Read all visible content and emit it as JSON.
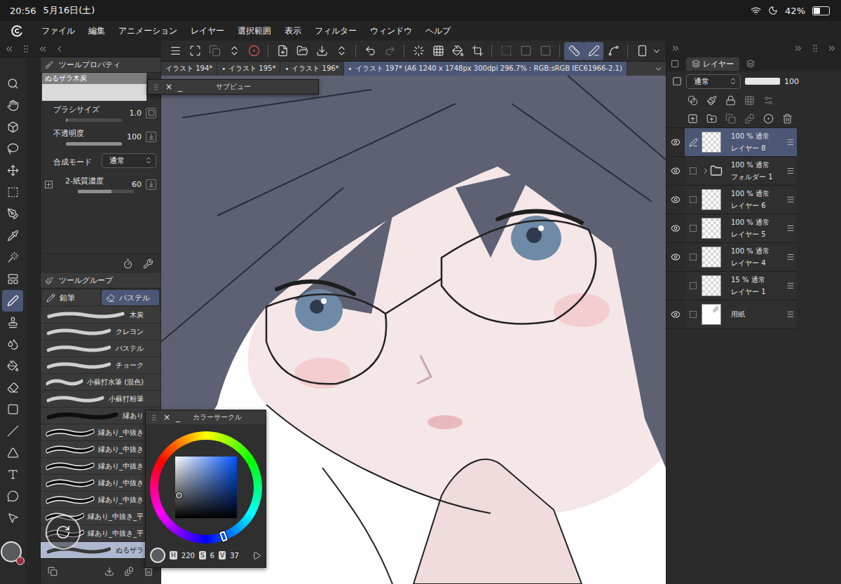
{
  "status_bar": {
    "time": "20:56",
    "date": "5月16日(土)",
    "battery": "42%",
    "battery_level": 0.42
  },
  "menu": [
    "ファイル",
    "編集",
    "アニメーション",
    "レイヤー",
    "選択範囲",
    "表示",
    "フィルター",
    "ウィンドウ",
    "ヘルプ"
  ],
  "command_bar": [
    {
      "selected": false,
      "disabled": false
    },
    {
      "selected": false,
      "disabled": false
    },
    {
      "selected": false,
      "disabled": true
    },
    {
      "selected": false,
      "disabled": false
    },
    {
      "selected": false,
      "disabled": false
    },
    {
      "selected": false,
      "disabled": false
    },
    {
      "selected": false,
      "disabled": false
    },
    {
      "selected": false,
      "disabled": false
    },
    {
      "selected": false,
      "disabled": false
    },
    {
      "selected": false,
      "disabled": false
    },
    {
      "selected": false,
      "disabled": true
    },
    {
      "selected": false,
      "disabled": false
    },
    {
      "selected": false,
      "disabled": false
    },
    {
      "selected": false,
      "disabled": false
    },
    {
      "selected": false,
      "disabled": false
    },
    {
      "selected": false,
      "disabled": true
    },
    {
      "selected": false,
      "disabled": true
    },
    {
      "selected": false,
      "disabled": true
    },
    {
      "selected": true,
      "disabled": false
    },
    {
      "selected": true,
      "disabled": false
    },
    {
      "selected": false,
      "disabled": false
    },
    {
      "selected": false,
      "disabled": false
    }
  ],
  "document_tabs": [
    {
      "label": "イラスト 194*",
      "selected": false
    },
    {
      "marker": "•",
      "label": "イラスト 195*",
      "selected": false
    },
    {
      "marker": "•",
      "label": "イラスト 196*",
      "selected": false
    },
    {
      "marker": "•",
      "label": "イラスト 197* (A6 1240 x 1748px 300dpi 296.7% : RGB:sRGB IEC61966-2.1)",
      "selected": true
    }
  ],
  "tools": [
    {
      "selected": false
    },
    {
      "selected": false
    },
    {
      "selected": false
    },
    {
      "selected": false
    },
    {
      "selected": false
    },
    {
      "selected": false
    },
    {
      "selected": false
    },
    {
      "selected": false
    },
    {
      "selected": false
    },
    {
      "selected": false
    },
    {
      "selected": true
    },
    {
      "selected": false
    },
    {
      "selected": false
    },
    {
      "selected": false
    },
    {
      "selected": false
    },
    {
      "selected": false
    },
    {
      "selected": false
    },
    {
      "selected": false
    },
    {
      "selected": false
    },
    {
      "selected": false
    },
    {
      "selected": false
    }
  ],
  "tool_property": {
    "title": "ツールプロパティ",
    "brush": "ぬるザラ木炭",
    "rows": [
      {
        "kind": "slider",
        "label": "ブラシサイズ",
        "value": "1.0",
        "level": 0.03,
        "expandable": false
      },
      {
        "kind": "slider",
        "label": "不透明度",
        "value": "100",
        "level": 1,
        "expandable": false
      },
      {
        "kind": "select",
        "label": "合成モード",
        "value": "通常",
        "expandable": false
      },
      {
        "kind": "slider",
        "label": "2-紙質濃度",
        "value": "60",
        "level": 0.6,
        "expandable": true
      }
    ]
  },
  "tool_group": {
    "title": "ツールグループ",
    "tabs": [
      {
        "label": "鉛筆",
        "selected": false
      },
      {
        "label": "パステル",
        "selected": true
      }
    ],
    "brushes": [
      {
        "label": "木炭",
        "kind": "textured",
        "selected": false
      },
      {
        "label": "クレヨン",
        "kind": "textured",
        "selected": false
      },
      {
        "label": "パステル",
        "kind": "textured",
        "selected": false
      },
      {
        "label": "チョーク",
        "kind": "textured",
        "selected": false
      },
      {
        "label": "小蘇打水筆 (混色)",
        "kind": "textured",
        "selected": false
      },
      {
        "label": "小蘇打粉筆",
        "kind": "textured",
        "selected": false
      },
      {
        "label": "縁あり",
        "kind": "solid",
        "selected": false
      },
      {
        "label": "縁あり_中抜き",
        "kind": "outlined",
        "selected": false
      },
      {
        "label": "縁あり_中抜き",
        "kind": "outlined",
        "selected": false
      },
      {
        "label": "縁あり_中抜き",
        "kind": "outlined",
        "selected": false
      },
      {
        "label": "縁あり_中抜き",
        "kind": "outlined",
        "selected": false
      },
      {
        "label": "縁あり_中抜き",
        "kind": "outlined",
        "selected": false
      },
      {
        "label": "縁あり_中抜き_平",
        "kind": "outlined",
        "selected": false
      },
      {
        "label": "縁あり_中抜き_平",
        "kind": "outlined",
        "selected": false
      },
      {
        "label": "ぬるザラ",
        "kind": "textured",
        "selected": true
      }
    ]
  },
  "layer_panel": {
    "tab": "レイヤー",
    "blend": "通常",
    "opacity": "100",
    "opacity_level": 1,
    "layers": [
      {
        "kind": "layer",
        "opacity": "100 %",
        "mode": "通常",
        "name": "レイヤー 8",
        "visible": true,
        "editing": true,
        "selected": true
      },
      {
        "kind": "folder",
        "opacity": "100 %",
        "mode": "通常",
        "name": "フォルダー 1",
        "visible": true,
        "editing": false,
        "selected": false,
        "expanded": false
      },
      {
        "kind": "layer",
        "opacity": "100 %",
        "mode": "通常",
        "name": "レイヤー 6",
        "visible": true,
        "editing": false,
        "selected": false
      },
      {
        "kind": "layer",
        "opacity": "100 %",
        "mode": "通常",
        "name": "レイヤー 5",
        "visible": true,
        "editing": false,
        "selected": false
      },
      {
        "kind": "layer",
        "opacity": "100 %",
        "mode": "通常",
        "name": "レイヤー 4",
        "visible": true,
        "editing": false,
        "selected": false
      },
      {
        "kind": "layer",
        "opacity": "15 %",
        "mode": "通常",
        "name": "レイヤー 1",
        "visible": false,
        "editing": false,
        "selected": false
      },
      {
        "kind": "paper",
        "name": "用紙",
        "visible": true,
        "editing": false,
        "selected": false
      }
    ]
  },
  "sub_view": {
    "title": "サブビュー"
  },
  "color_circle": {
    "title": "カラーサークル",
    "h_label": "H",
    "h": "220",
    "s_label": "S",
    "s": "6",
    "v_label": "V",
    "v": "37"
  },
  "window_controls": {
    "close": "×",
    "minimize": "_"
  }
}
